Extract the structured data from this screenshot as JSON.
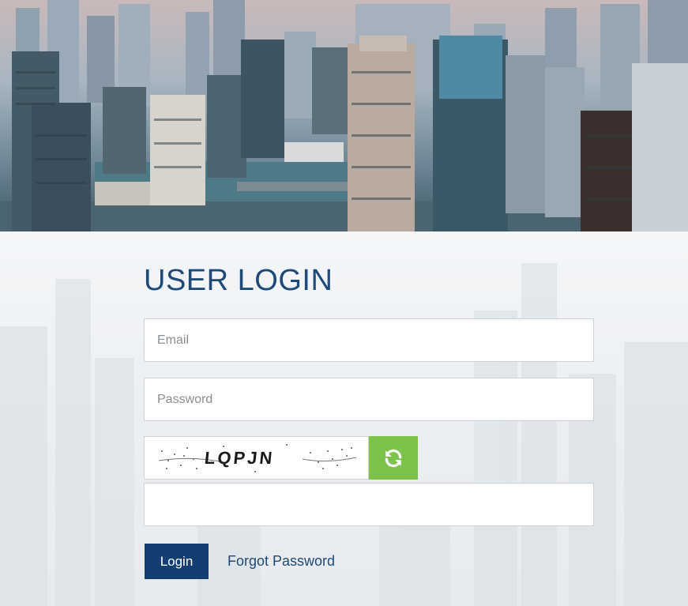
{
  "login": {
    "title": "USER LOGIN",
    "email_placeholder": "Email",
    "password_placeholder": "Password",
    "captcha_text": "LQPJN",
    "captcha_answer_value": "",
    "login_label": "Login",
    "forgot_label": "Forgot Password"
  },
  "icons": {
    "refresh": "refresh-icon"
  },
  "colors": {
    "title": "#1f4a77",
    "login_button": "#123e72",
    "refresh_button": "#7cc14a",
    "field_border": "#cfd3d7"
  }
}
